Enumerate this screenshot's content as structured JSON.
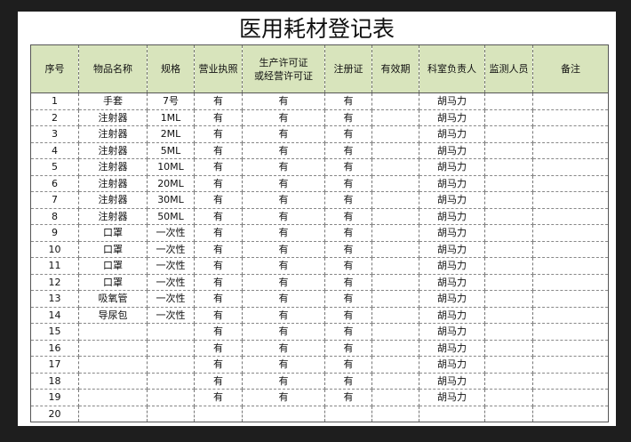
{
  "title": "医用耗材登记表",
  "columns": [
    {
      "label": "序号"
    },
    {
      "label": "物品名称"
    },
    {
      "label": "规格"
    },
    {
      "label": "营业执照"
    },
    {
      "label": "生产许可证",
      "label2": "或经营许可证"
    },
    {
      "label": "注册证"
    },
    {
      "label": "有效期"
    },
    {
      "label": "科室负责人"
    },
    {
      "label": "监测人员"
    },
    {
      "label": "备注"
    }
  ],
  "rows": [
    [
      "1",
      "手套",
      "7号",
      "有",
      "有",
      "有",
      "",
      "胡马力",
      "",
      ""
    ],
    [
      "2",
      "注射器",
      "1ML",
      "有",
      "有",
      "有",
      "",
      "胡马力",
      "",
      ""
    ],
    [
      "3",
      "注射器",
      "2ML",
      "有",
      "有",
      "有",
      "",
      "胡马力",
      "",
      ""
    ],
    [
      "4",
      "注射器",
      "5ML",
      "有",
      "有",
      "有",
      "",
      "胡马力",
      "",
      ""
    ],
    [
      "5",
      "注射器",
      "10ML",
      "有",
      "有",
      "有",
      "",
      "胡马力",
      "",
      ""
    ],
    [
      "6",
      "注射器",
      "20ML",
      "有",
      "有",
      "有",
      "",
      "胡马力",
      "",
      ""
    ],
    [
      "7",
      "注射器",
      "30ML",
      "有",
      "有",
      "有",
      "",
      "胡马力",
      "",
      ""
    ],
    [
      "8",
      "注射器",
      "50ML",
      "有",
      "有",
      "有",
      "",
      "胡马力",
      "",
      ""
    ],
    [
      "9",
      "口罩",
      "一次性",
      "有",
      "有",
      "有",
      "",
      "胡马力",
      "",
      ""
    ],
    [
      "10",
      "口罩",
      "一次性",
      "有",
      "有",
      "有",
      "",
      "胡马力",
      "",
      ""
    ],
    [
      "11",
      "口罩",
      "一次性",
      "有",
      "有",
      "有",
      "",
      "胡马力",
      "",
      ""
    ],
    [
      "12",
      "口罩",
      "一次性",
      "有",
      "有",
      "有",
      "",
      "胡马力",
      "",
      ""
    ],
    [
      "13",
      "吸氧管",
      "一次性",
      "有",
      "有",
      "有",
      "",
      "胡马力",
      "",
      ""
    ],
    [
      "14",
      "导尿包",
      "一次性",
      "有",
      "有",
      "有",
      "",
      "胡马力",
      "",
      ""
    ],
    [
      "15",
      "",
      "",
      "有",
      "有",
      "有",
      "",
      "胡马力",
      "",
      ""
    ],
    [
      "16",
      "",
      "",
      "有",
      "有",
      "有",
      "",
      "胡马力",
      "",
      ""
    ],
    [
      "17",
      "",
      "",
      "有",
      "有",
      "有",
      "",
      "胡马力",
      "",
      ""
    ],
    [
      "18",
      "",
      "",
      "有",
      "有",
      "有",
      "",
      "胡马力",
      "",
      ""
    ],
    [
      "19",
      "",
      "",
      "有",
      "有",
      "有",
      "",
      "胡马力",
      "",
      ""
    ],
    [
      "20",
      "",
      "",
      "",
      "",
      "",
      "",
      "",
      "",
      ""
    ]
  ],
  "colors": {
    "header_bg": "#d8e4bc",
    "page_bg": "#1e1e1e"
  }
}
